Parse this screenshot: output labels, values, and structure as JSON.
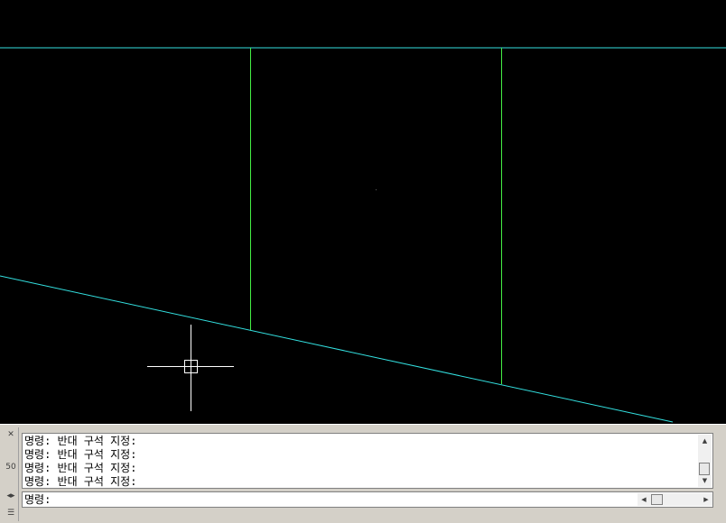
{
  "canvas": {
    "background": "#000000",
    "colors": {
      "cyan_line": "#33e0e0",
      "green_line": "#44ee44",
      "crosshair": "#ffffff"
    }
  },
  "command_window": {
    "handle_icons": [
      "pin-icon",
      "properties-icon",
      "resize-icon",
      "menu-icon"
    ],
    "handle_number": "50",
    "history": [
      "명령: 반대 구석 지정:",
      "명령: 반대 구석 지정:",
      "명령: 반대 구석 지정:",
      "명령: 반대 구석 지정:"
    ],
    "prompt_label": "명령:",
    "prompt_value": "",
    "scroll_up": "▲",
    "scroll_down": "▼",
    "scroll_left": "◀",
    "scroll_right": "▶"
  }
}
